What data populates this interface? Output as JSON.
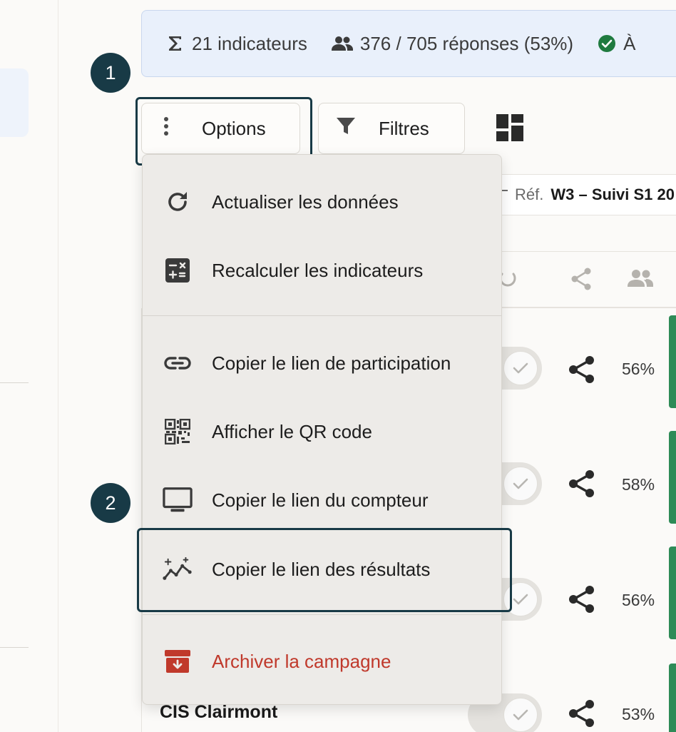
{
  "banner": {
    "indicators": "21 indicateurs",
    "responses": "376 / 705 réponses (53%)",
    "status_partial": "À"
  },
  "steps": {
    "step1": "1",
    "step2": "2"
  },
  "toolbar": {
    "options_label": "Options",
    "filters_label": "Filtres"
  },
  "reference": {
    "label": "Réf.",
    "value": "W3 – Suivi S1 20"
  },
  "rows": [
    {
      "name": "",
      "percent": "56%"
    },
    {
      "name": "",
      "percent": "58%"
    },
    {
      "name": "",
      "percent": "56%"
    },
    {
      "name": "CIS Clairmont",
      "percent": "53%"
    }
  ],
  "menu": {
    "refresh": "Actualiser les données",
    "recalculate": "Recalculer les indicateurs",
    "copy_participation_link": "Copier le lien de participation",
    "show_qr": "Afficher le QR code",
    "copy_counter_link": "Copier le lien du compteur",
    "copy_results_link": "Copier le lien des résultats",
    "archive": "Archiver la campagne"
  },
  "colors": {
    "accent_dark": "#183a46",
    "banner_bg": "#e9f0fb",
    "danger": "#c0392b",
    "success": "#2e8b57"
  },
  "icons": {
    "indicators": "sigma-icon",
    "responses": "users-icon",
    "status": "check-circle-icon",
    "options": "kebab-icon",
    "filters": "funnel-icon",
    "layout": "grid-icon",
    "refresh": "refresh-icon",
    "recalculate": "calculator-icon",
    "link": "link-icon",
    "qr": "qr-code-icon",
    "counter": "monitor-icon",
    "results": "sparkle-chart-icon",
    "archive": "archive-icon",
    "share": "share-icon",
    "power": "power-icon"
  }
}
